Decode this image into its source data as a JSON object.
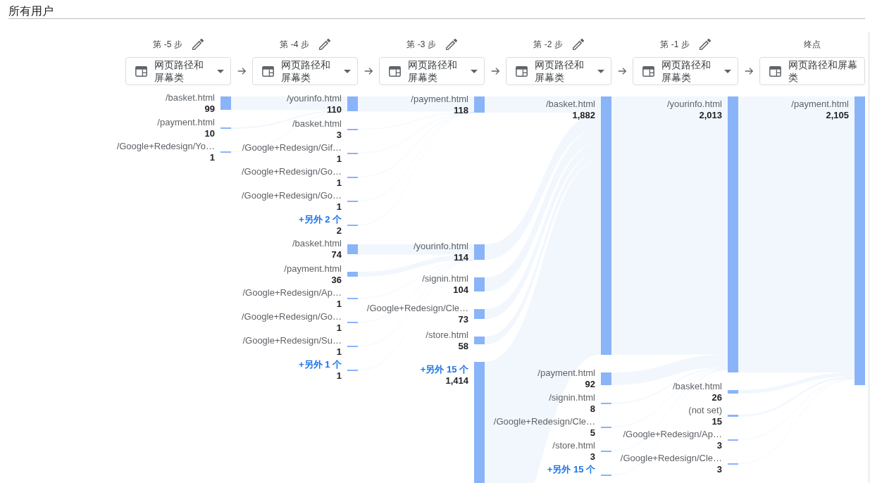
{
  "segment_title": "所有用户",
  "steps": [
    {
      "label": "第 -5 步",
      "editable": true,
      "dimension": "网页路径和屏幕类",
      "has_dropdown": true
    },
    {
      "label": "第 -4 步",
      "editable": true,
      "dimension": "网页路径和屏幕类",
      "has_dropdown": true
    },
    {
      "label": "第 -3 步",
      "editable": true,
      "dimension": "网页路径和屏幕类",
      "has_dropdown": true
    },
    {
      "label": "第 -2 步",
      "editable": true,
      "dimension": "网页路径和屏幕类",
      "has_dropdown": true
    },
    {
      "label": "第 -1 步",
      "editable": true,
      "dimension": "网页路径和屏幕类",
      "has_dropdown": true
    },
    {
      "label": "终点",
      "editable": false,
      "dimension": "网页路径和屏幕类",
      "has_dropdown": false
    }
  ],
  "path_tree": {
    "kind": "page",
    "name": "/payment.html",
    "value": "2,105",
    "children": [
      {
        "kind": "page",
        "name": "/yourinfo.html",
        "value": "2,013",
        "children": [
          {
            "kind": "page",
            "name": "/basket.html",
            "value": "1,882",
            "children": [
              {
                "kind": "page",
                "name": "/payment.html",
                "value": "118",
                "children": [
                  {
                    "kind": "page",
                    "name": "/yourinfo.html",
                    "value": "110",
                    "children": [
                      {
                        "kind": "page",
                        "name": "/basket.html",
                        "value": "99"
                      },
                      {
                        "kind": "page",
                        "name": "/payment.html",
                        "value": "10"
                      },
                      {
                        "kind": "page",
                        "name": "/Google+Redesign/Yo…",
                        "value": "1"
                      }
                    ]
                  },
                  {
                    "kind": "page",
                    "name": "/basket.html",
                    "value": "3"
                  },
                  {
                    "kind": "page",
                    "name": "/Google+Redesign/Gif…",
                    "value": "1"
                  },
                  {
                    "kind": "page",
                    "name": "/Google+Redesign/Go…",
                    "value": "1"
                  },
                  {
                    "kind": "page",
                    "name": "/Google+Redesign/Go…",
                    "value": "1"
                  },
                  {
                    "kind": "more",
                    "name": "+另外 2 个",
                    "value": "2"
                  }
                ]
              },
              {
                "kind": "page",
                "name": "/yourinfo.html",
                "value": "114",
                "children": [
                  {
                    "kind": "page",
                    "name": "/basket.html",
                    "value": "74"
                  },
                  {
                    "kind": "page",
                    "name": "/payment.html",
                    "value": "36"
                  },
                  {
                    "kind": "page",
                    "name": "/Google+Redesign/Ap…",
                    "value": "1"
                  },
                  {
                    "kind": "page",
                    "name": "/Google+Redesign/Go…",
                    "value": "1"
                  },
                  {
                    "kind": "page",
                    "name": "/Google+Redesign/Su…",
                    "value": "1"
                  },
                  {
                    "kind": "more",
                    "name": "+另外 1 个",
                    "value": "1"
                  }
                ]
              },
              {
                "kind": "page",
                "name": "/signin.html",
                "value": "104"
              },
              {
                "kind": "page",
                "name": "/Google+Redesign/Cle…",
                "value": "73"
              },
              {
                "kind": "page",
                "name": "/store.html",
                "value": "58"
              },
              {
                "kind": "more",
                "name": "+另外 15 个",
                "value": "1,414"
              }
            ]
          },
          {
            "kind": "page",
            "name": "/payment.html",
            "value": "92"
          },
          {
            "kind": "page",
            "name": "/signin.html",
            "value": "8"
          },
          {
            "kind": "page",
            "name": "/Google+Redesign/Cle…",
            "value": "5"
          },
          {
            "kind": "page",
            "name": "/store.html",
            "value": "3"
          },
          {
            "kind": "more",
            "name": "+另外 15 个"
          }
        ]
      },
      {
        "kind": "page",
        "name": "/basket.html",
        "value": "26"
      },
      {
        "kind": "page",
        "name": "(not set)",
        "value": "15"
      },
      {
        "kind": "page",
        "name": "/Google+Redesign/Ap…",
        "value": "3"
      },
      {
        "kind": "page",
        "name": "/Google+Redesign/Cle…",
        "value": "3"
      }
    ]
  }
}
